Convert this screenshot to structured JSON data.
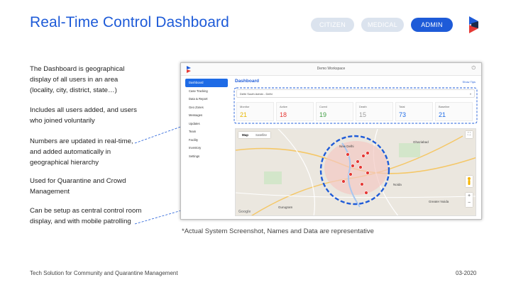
{
  "title": "Real-Time Control Dashboard",
  "role_tabs": [
    "CITIZEN",
    "MEDICAL",
    "ADMIN"
  ],
  "bullets": [
    "The Dashboard is geographical display of all users in an area (locality, city, district, state…)",
    "Includes all users added, and users who joined voluntarily",
    "Numbers are updated in real-time, and added automatically in geographical hierarchy",
    "Used for Quarantine and Crowd Management",
    "Can be setup as central control room display, and with mobile patrolling"
  ],
  "app": {
    "window_title": "Demo Workspace",
    "sidebar": [
      "Dashboard",
      "Case Tracking",
      "Data & Report",
      "Geo Zones",
      "Messages",
      "Updates",
      "Team",
      "Facility",
      "Inventory",
      "Settings"
    ],
    "dashboard_title": "Dashboard",
    "show_tips": "Show Tips",
    "area": "Delhi South Admin - Delhi",
    "stats": [
      {
        "label": "Monitor",
        "value": "21",
        "color": "#e8b800"
      },
      {
        "label": "Active",
        "value": "18",
        "color": "#e53935"
      },
      {
        "label": "Cured",
        "value": "19",
        "color": "#43a047"
      },
      {
        "label": "Death",
        "value": "15",
        "color": "#9e9e9e"
      },
      {
        "label": "Total",
        "value": "73",
        "color": "#1e6be6"
      },
      {
        "label": "Baseline",
        "value": "21",
        "color": "#1e6be6"
      }
    ],
    "map": {
      "tabs": [
        "Map",
        "Satellite"
      ],
      "labels": [
        "New Delhi",
        "Gurugram",
        "Noida",
        "Ghaziabad",
        "Greater Noida"
      ],
      "attribution": "Google"
    }
  },
  "disclaimer": "*Actual System Screenshot, Names and Data are representative",
  "footer": {
    "left": "Tech Solution for Community and Quarantine Management",
    "right": "03-2020"
  }
}
